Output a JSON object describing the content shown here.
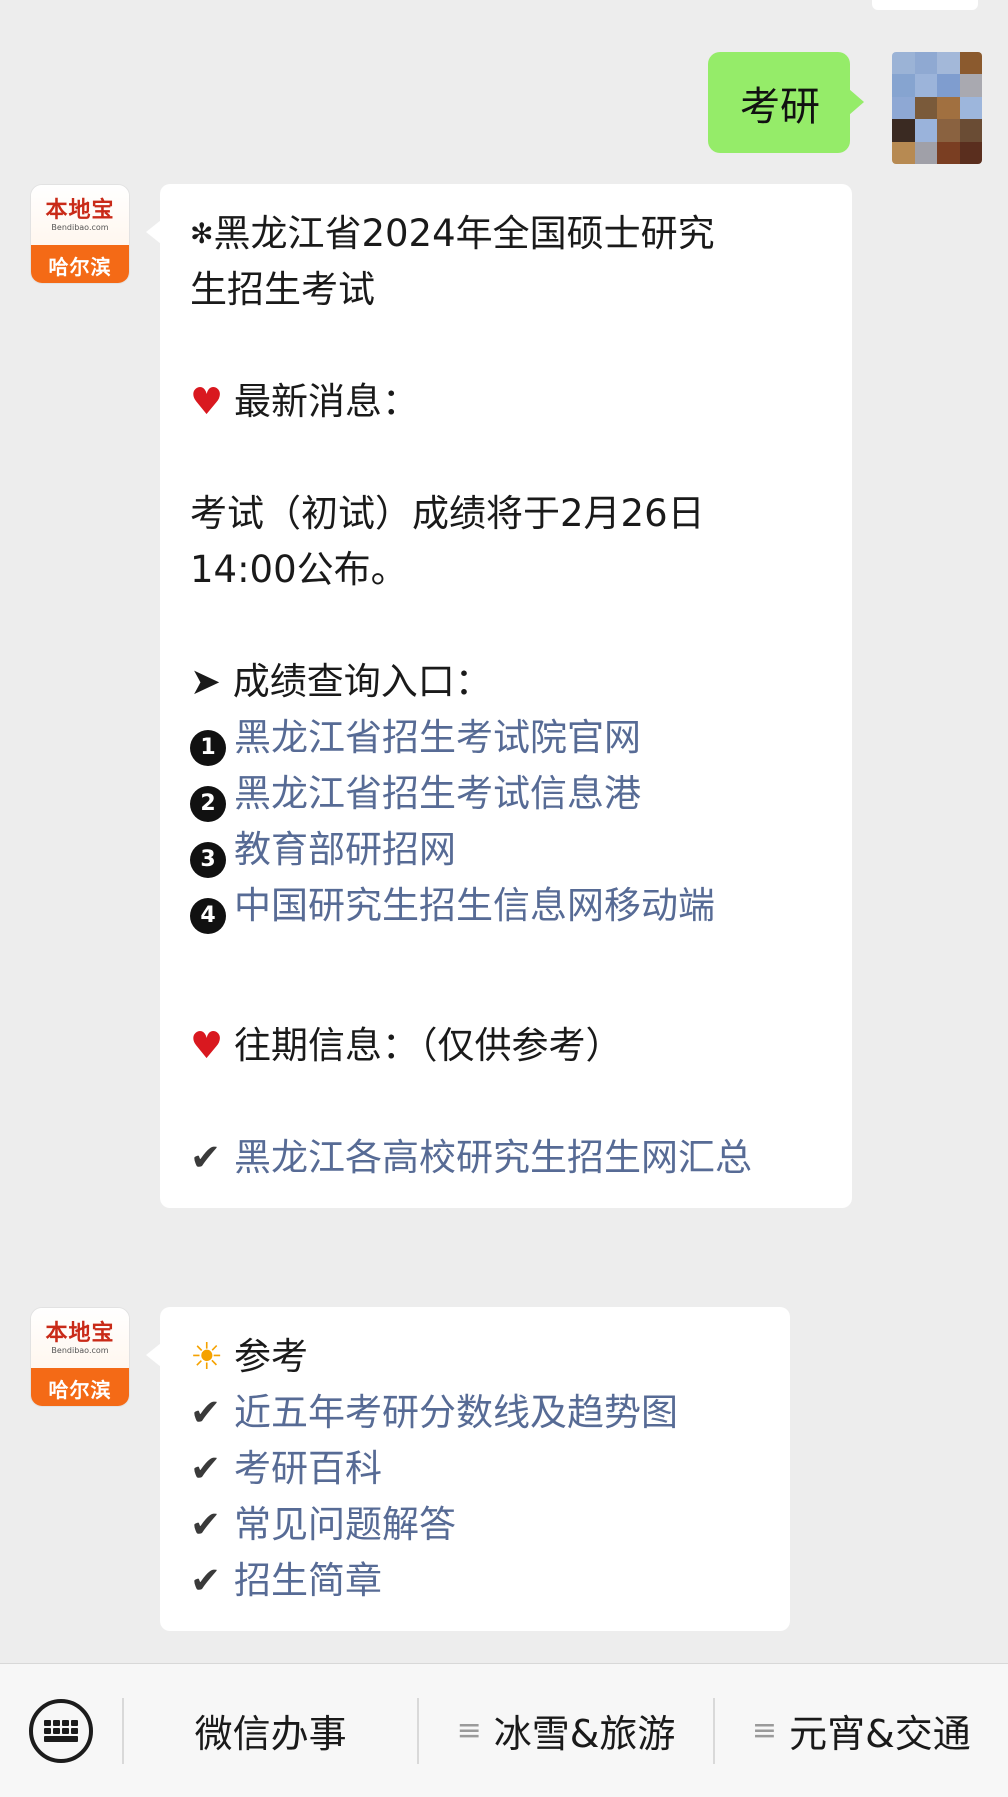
{
  "outgoing_message": {
    "text": "考研"
  },
  "incoming_avatar": {
    "logo": "本地宝",
    "domain": "Bendibao.com",
    "city": "哈尔滨"
  },
  "message1": {
    "title_icon": "✻",
    "title_line1": "黑龙江省2024年全国硕士研究",
    "title_line2": "生招生考试",
    "latest_heading": "最新消息：",
    "news_line1": "考试（初试）成绩将于2月26日",
    "news_line2": "14:00公布。",
    "query_heading": "➤ 成绩查询入口：",
    "links": [
      {
        "badge": "1",
        "label": "黑龙江省招生考试院官网"
      },
      {
        "badge": "2",
        "label": "黑龙江省招生考试信息港"
      },
      {
        "badge": "3",
        "label": "教育部研招网"
      },
      {
        "badge": "4",
        "label": "中国研究生招生信息网移动端"
      }
    ],
    "past_heading": "往期信息：（仅供参考）",
    "past_link": "黑龙江各高校研究生招生网汇总"
  },
  "message2": {
    "heading": "参考",
    "links": [
      "近五年考研分数线及趋势图",
      "考研百科",
      "常见问题解答",
      "招生简章"
    ]
  },
  "bottom_menu": {
    "items": [
      "微信办事",
      "冰雪&旅游",
      "元宵&交通"
    ]
  },
  "colors": {
    "chat_background": "#ededed",
    "outgoing_bubble": "#95ec69",
    "link": "#576b95",
    "badge_orange": "#f46a16"
  },
  "icons": {
    "heart": "heart-icon",
    "sun": "sun-icon",
    "check": "check-icon",
    "keyboard": "keyboard-icon",
    "menu": "menu-lines-icon"
  }
}
